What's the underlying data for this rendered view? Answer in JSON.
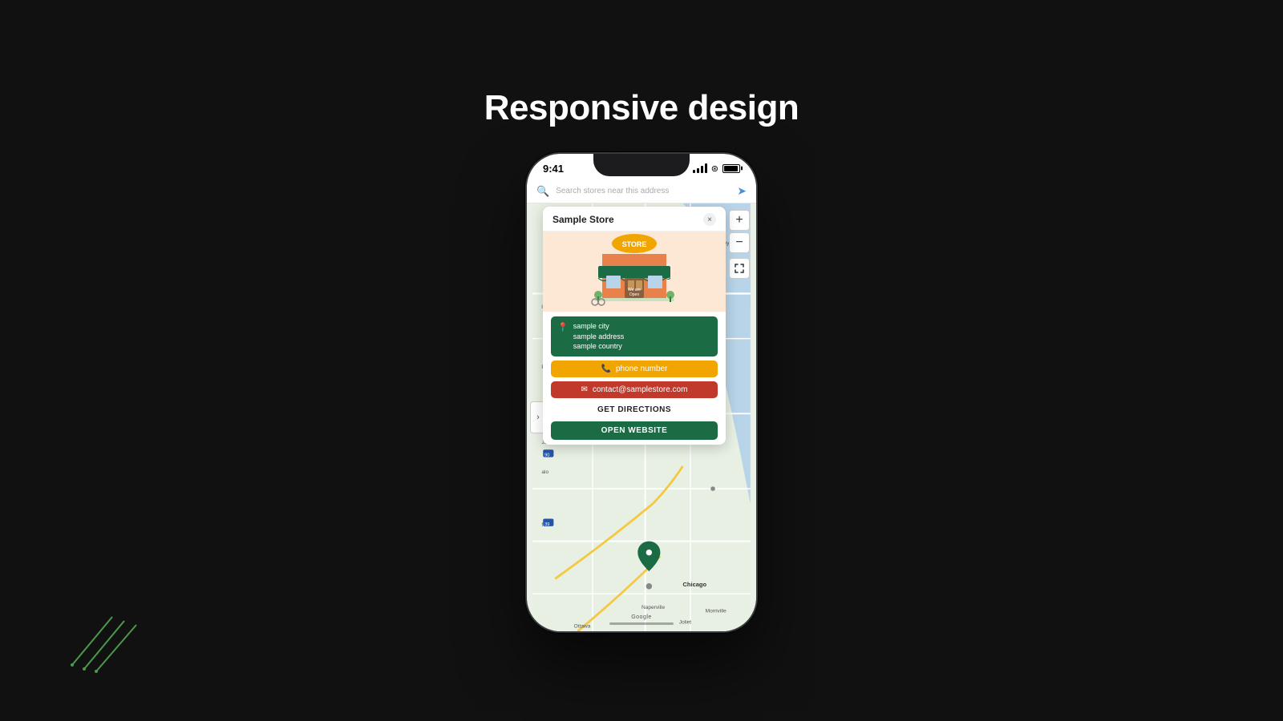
{
  "page": {
    "title": "Responsive design",
    "background_color": "#111111"
  },
  "phone": {
    "status_bar": {
      "time": "9:41"
    },
    "search": {
      "placeholder": "Search stores near this address"
    },
    "store_card": {
      "title": "Sample Store",
      "close_label": "×",
      "address": {
        "city": "sample city",
        "street": "sample address",
        "country": "sample country"
      },
      "phone": {
        "label": "phone number"
      },
      "email": {
        "label": "contact@samplestore.com"
      },
      "directions_label": "GET DIRECTIONS",
      "open_website_label": "OPEN WEBSITE"
    },
    "map": {
      "zoom_in_label": "+",
      "zoom_out_label": "−",
      "expand_label": "›",
      "google_label": "Google"
    }
  },
  "decorative": {
    "lines_color": "#3a7a3a"
  }
}
